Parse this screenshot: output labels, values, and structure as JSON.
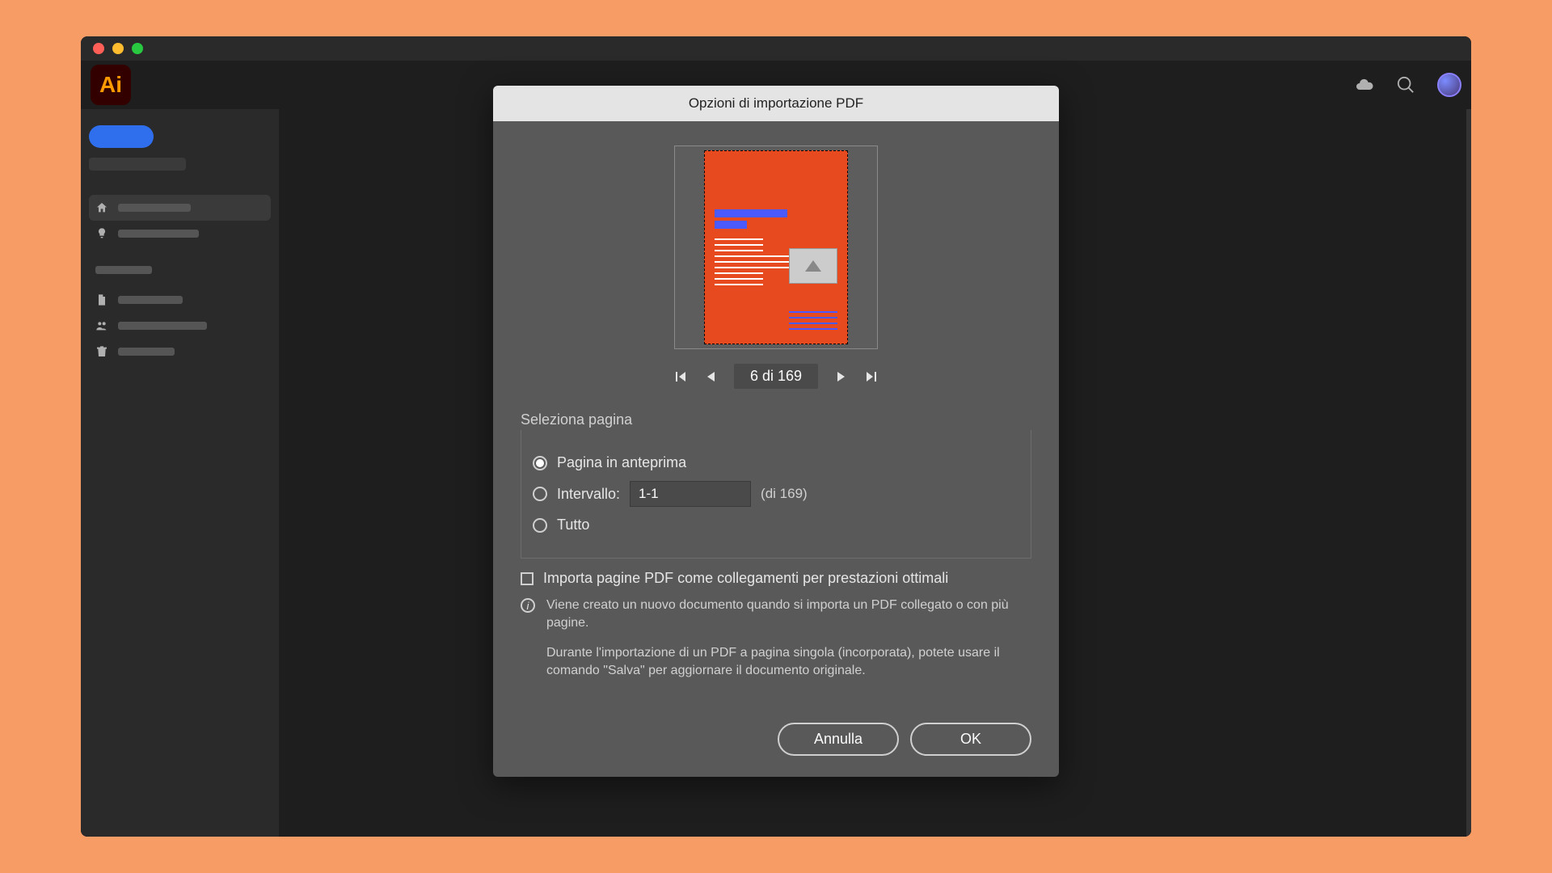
{
  "app": {
    "logo": "Ai"
  },
  "dialog": {
    "title": "Opzioni di importazione PDF",
    "page_nav": {
      "current": "6",
      "sep": "di",
      "total": "169"
    },
    "section_select_page": "Seleziona pagina",
    "radio_preview": "Pagina in anteprima",
    "radio_range": "Intervallo:",
    "range_value": "1-1",
    "range_total": "(di 169)",
    "radio_all": "Tutto",
    "checkbox_import_links": "Importa pagine PDF come collegamenti per prestazioni ottimali",
    "info_text1": "Viene creato un nuovo documento quando si importa un PDF collegato o con più pagine.",
    "info_text2": "Durante l'importazione di un PDF a pagina singola (incorporata), potete usare il comando \"Salva\" per aggiornare il documento originale.",
    "btn_cancel": "Annulla",
    "btn_ok": "OK"
  }
}
